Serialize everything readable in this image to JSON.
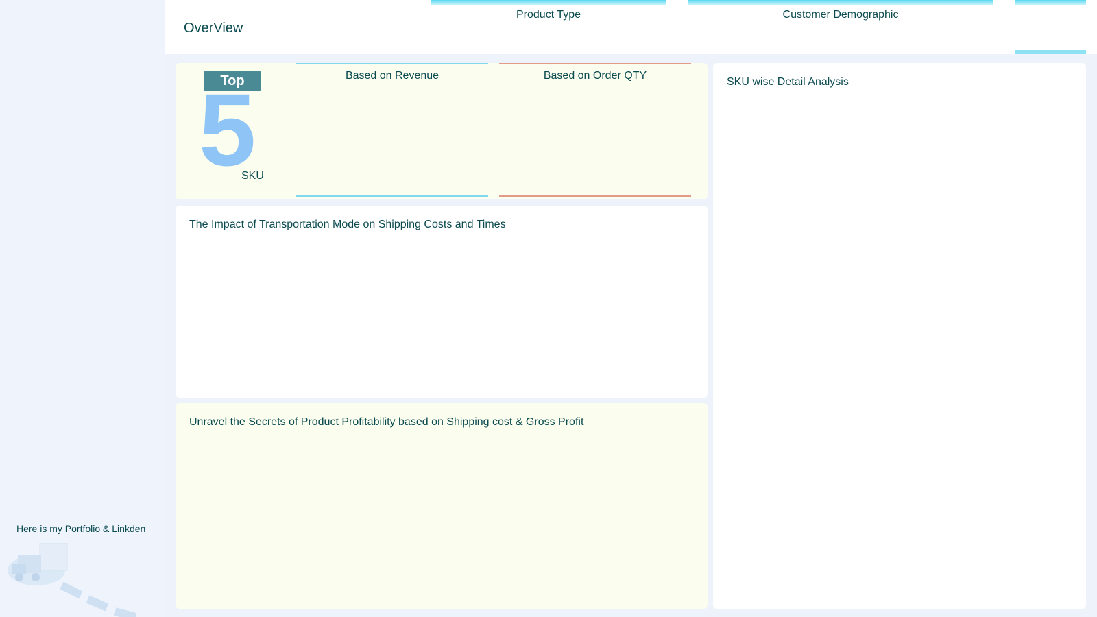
{
  "sidebar": {
    "portfolio_text": "Here is my Portfolio & Linkden",
    "illustration_icon": "forklift-boxes-icon"
  },
  "header": {
    "title": "OverView",
    "tabs": [
      {
        "label": "Product Type"
      },
      {
        "label": "Customer Demographic"
      },
      {
        "label": ""
      }
    ]
  },
  "top5": {
    "badge": "Top",
    "number": "5",
    "unit": "SKU",
    "revenue_title": "Based on Revenue",
    "qty_title": "Based on Order QTY"
  },
  "panels": {
    "transport_title": "The Impact of Transportation Mode on Shipping Costs and Times",
    "profit_title": "Unravel the Secrets of Product Profitability based on Shipping cost & Gross Profit",
    "sku_detail_title": "SKU wise Detail Analysis"
  },
  "colors": {
    "accent_cyan": "#5cd8f0",
    "accent_coral": "#e39a86",
    "badge": "#4a8a94",
    "big_number": "#8ec5f6",
    "text": "#0b4a4f"
  }
}
